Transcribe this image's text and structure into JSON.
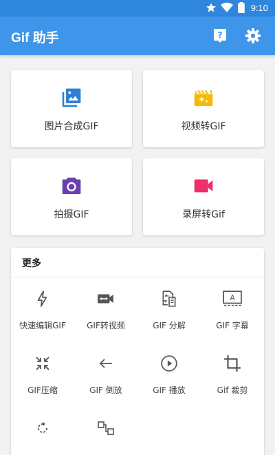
{
  "status_bar": {
    "time": "9:10",
    "icons": [
      "star-icon",
      "wifi-icon",
      "battery-icon"
    ]
  },
  "app_bar": {
    "title": "Gif 助手",
    "actions": [
      "help-icon",
      "settings-icon"
    ],
    "color": "#3e95ea"
  },
  "main_actions": [
    {
      "label": "图片合成GIF",
      "icon": "photo-library-icon",
      "color": "#2f7fd0"
    },
    {
      "label": "视频转GIF",
      "icon": "movie-clapper-icon",
      "color": "#f5b90a"
    },
    {
      "label": "拍摄GIF",
      "icon": "camera-icon",
      "color": "#6a3fb0"
    },
    {
      "label": "录屏转Gif",
      "icon": "videocam-icon",
      "color": "#ee2f6a"
    }
  ],
  "more": {
    "title": "更多",
    "items": [
      {
        "label": "快速编辑GIF",
        "icon": "flash-icon"
      },
      {
        "label": "GIF转视频",
        "icon": "video-swap-icon"
      },
      {
        "label": "GIF 分解",
        "icon": "split-icon"
      },
      {
        "label": "GIF 字幕",
        "icon": "subtitle-icon"
      },
      {
        "label": "GIF压缩",
        "icon": "compress-icon"
      },
      {
        "label": "GIF 倒放",
        "icon": "arrow-back-icon"
      },
      {
        "label": "GIF 播放",
        "icon": "play-circle-icon"
      },
      {
        "label": "Gif 裁剪",
        "icon": "crop-icon"
      },
      {
        "label": "",
        "icon": "rotate-icon"
      },
      {
        "label": "",
        "icon": "link-nodes-icon"
      }
    ]
  }
}
